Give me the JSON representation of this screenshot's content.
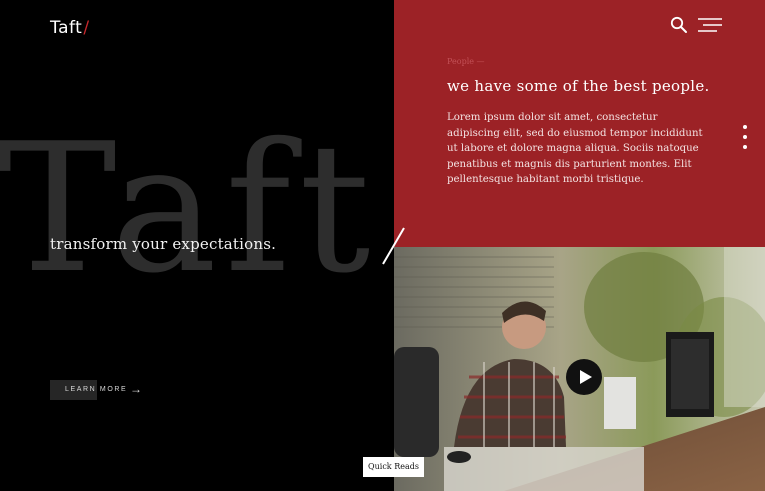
{
  "brand": {
    "name": "Taft",
    "slash": "/"
  },
  "hero": {
    "big_word": "Taft",
    "tagline": "transform your expectations.",
    "cta_label": "LEARN MORE",
    "cta_arrow": "→"
  },
  "header": {
    "search_icon": "search-icon",
    "menu_icon": "hamburger-menu-icon"
  },
  "people": {
    "label": "People —",
    "headline": "we have some of the best people.",
    "body": "Lorem ipsum dolor sit amet, consectetur adipiscing elit, sed do eiusmod tempor incididunt ut labore et dolore magna aliqua. Sociis natoque penatibus et magnis dis parturient montes. Elit pellentesque habitant morbi tristique."
  },
  "video": {
    "play_icon": "play-icon"
  },
  "quick_reads": {
    "label": "Quick Reads"
  },
  "colors": {
    "accent": "#9c2226",
    "background": "#000000",
    "big_word": "#2d2d2d"
  }
}
